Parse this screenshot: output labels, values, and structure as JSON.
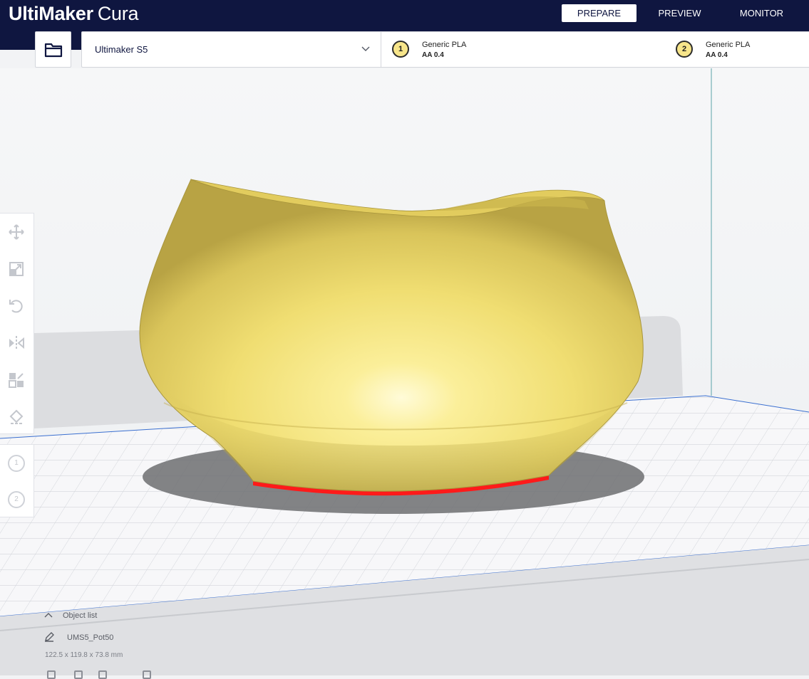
{
  "app": {
    "brand": "UltiMaker",
    "product": "Cura"
  },
  "stages": [
    {
      "label": "PREPARE",
      "active": true
    },
    {
      "label": "PREVIEW",
      "active": false
    },
    {
      "label": "MONITOR",
      "active": false
    }
  ],
  "open_file": {
    "icon": "folder-icon"
  },
  "printer": {
    "name": "Ultimaker S5",
    "icon": "chevron-down-icon"
  },
  "extruders": [
    {
      "index": "1",
      "material": "Generic PLA",
      "nozzle": "AA 0.4"
    },
    {
      "index": "2",
      "material": "Generic PLA",
      "nozzle": "AA 0.4"
    }
  ],
  "tools": [
    {
      "name": "move-icon"
    },
    {
      "name": "scale-icon"
    },
    {
      "name": "rotate-icon"
    },
    {
      "name": "mirror-icon"
    },
    {
      "name": "per-model-settings-icon"
    },
    {
      "name": "support-blocker-icon"
    }
  ],
  "extruder_tools": [
    "1",
    "2"
  ],
  "object_list": {
    "label": "Object list",
    "object_name": "UMS5_Pot50",
    "dimensions": "122.5 x 119.8 x 73.8 mm"
  },
  "colors": {
    "header": "#0f1640",
    "model": "#f3e073",
    "model_highlight": "#fffbd0",
    "model_shadow": "#b09d3c",
    "overhang": "#ff1a1a",
    "build_plate": "#f7f7f9",
    "grid": "#d0d2d8",
    "accent_blue": "#3a6fd0"
  }
}
